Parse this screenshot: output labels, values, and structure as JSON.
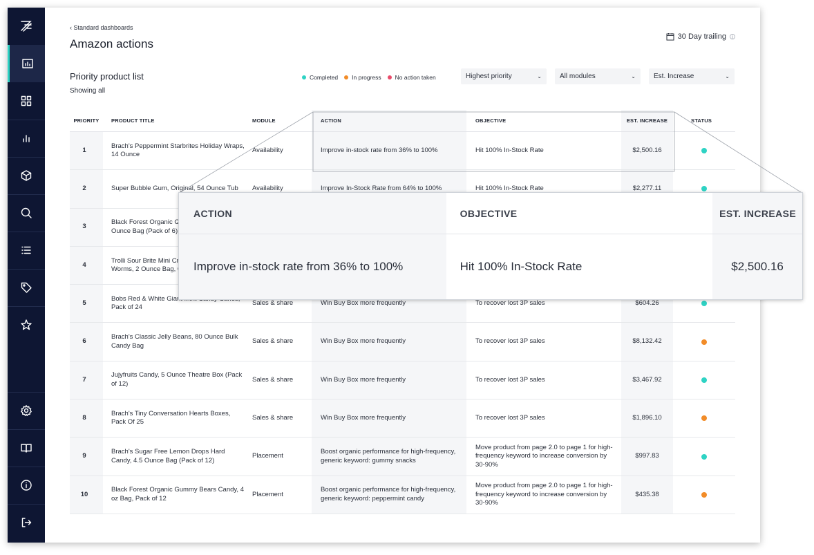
{
  "breadcrumb": "‹ Standard dashboards",
  "page_title": "Amazon actions",
  "date_range": "30 Day trailing",
  "date_info_icon": "info-icon",
  "section": {
    "title": "Priority product list",
    "subtitle": "Showing all"
  },
  "legend": [
    {
      "label": "Completed",
      "color": "#2ed3c4"
    },
    {
      "label": "In progress",
      "color": "#f28c28"
    },
    {
      "label": "No action taken",
      "color": "#e94b6a"
    }
  ],
  "filters": {
    "sort": "Highest priority",
    "modules": "All modules",
    "metric": "Est. Increase"
  },
  "columns": [
    "PRIORITY",
    "PRODUCT TITLE",
    "MODULE",
    "ACTION",
    "OBJECTIVE",
    "EST. INCREASE",
    "STATUS"
  ],
  "status_colors": {
    "completed": "#2ed3c4",
    "in_progress": "#f28c28",
    "no_action": "#e94b6a"
  },
  "rows": [
    {
      "priority": "1",
      "title": "Brach's Peppermint Starbrites Holiday Wraps, 14 Ounce",
      "module": "Availability",
      "action": "Improve in-stock rate from 36% to 100%",
      "objective": "Hit 100% In-Stock Rate",
      "est": "$2,500.16",
      "status": "completed"
    },
    {
      "priority": "2",
      "title": "Super Bubble Gum, Original, 54 Ounce Tub",
      "module": "Availability",
      "action": "Improve In-Stock Rate from 64% to 100%",
      "objective": "Hit 100% In-Stock Rate",
      "est": "$2,277.11",
      "status": "completed"
    },
    {
      "priority": "3",
      "title": "Black Forest Organic Gummy Bears, 8-Ounce Bag (Pack of 6)",
      "module": "",
      "action": "",
      "objective": "",
      "est": "",
      "status": "completed"
    },
    {
      "priority": "4",
      "title": "Trolli Sour Brite Mini Crawlers Gummy Worms, 2 Ounce Bag, Gummy Worms 2 Oz",
      "module": "",
      "action": "",
      "objective": "",
      "est": "",
      "status": "completed"
    },
    {
      "priority": "5",
      "title": "Bobs Red & White Giant Mint Candy Canes, Pack of 24",
      "module": "Sales & share",
      "action": "Win Buy Box more frequently",
      "objective": "To recover lost 3P sales",
      "est": "$604.26",
      "status": "completed"
    },
    {
      "priority": "6",
      "title": "Brach's Classic Jelly Beans, 80 Ounce Bulk Candy Bag",
      "module": "Sales & share",
      "action": "Win Buy Box more frequently",
      "objective": "To recover lost 3P sales",
      "est": "$8,132.42",
      "status": "in_progress"
    },
    {
      "priority": "7",
      "title": "Jujyfruits Candy, 5 Ounce Theatre Box (Pack of 12)",
      "module": "Sales & share",
      "action": "Win Buy Box more frequently",
      "objective": "To recover lost 3P sales",
      "est": "$3,467.92",
      "status": "completed"
    },
    {
      "priority": "8",
      "title": "Brach's Tiny Conversation Hearts Boxes, Pack Of 25",
      "module": "Sales & share",
      "action": "Win Buy Box more frequently",
      "objective": "To recover lost 3P sales",
      "est": "$1,896.10",
      "status": "in_progress"
    },
    {
      "priority": "9",
      "title": "Brach's Sugar Free Lemon Drops Hard Candy, 4.5 Ounce Bag (Pack of 12)",
      "module": "Placement",
      "action": "Boost organic performance for high-frequency, generic keyword: gummy snacks",
      "objective": "Move product from page 2.0 to page 1 for high-frequency keyword to increase conversion by 30-90%",
      "est": "$997.83",
      "status": "completed"
    },
    {
      "priority": "10",
      "title": "Black Forest Organic Gummy Bears Candy, 4 oz Bag, Pack of 12",
      "module": "Placement",
      "action": "Boost organic performance for high-frequency, generic keyword: peppermint candy",
      "objective": "Move product from page 2.0 to page 1 for high-frequency keyword to increase conversion by 30-90%",
      "est": "$435.38",
      "status": "in_progress"
    }
  ],
  "callout": {
    "headers": [
      "ACTION",
      "OBJECTIVE",
      "EST. INCREASE"
    ],
    "action": "Improve in-stock rate from 36% to 100%",
    "objective": "Hit 100% In-Stock Rate",
    "est": "$2,500.16"
  },
  "sidebar_icons": [
    "logo-icon",
    "dashboard-icon",
    "grid-icon",
    "bar-chart-icon",
    "box-icon",
    "search-icon",
    "list-icon",
    "tag-icon",
    "star-icon",
    "settings-icon",
    "book-icon",
    "info-icon",
    "logout-icon"
  ]
}
